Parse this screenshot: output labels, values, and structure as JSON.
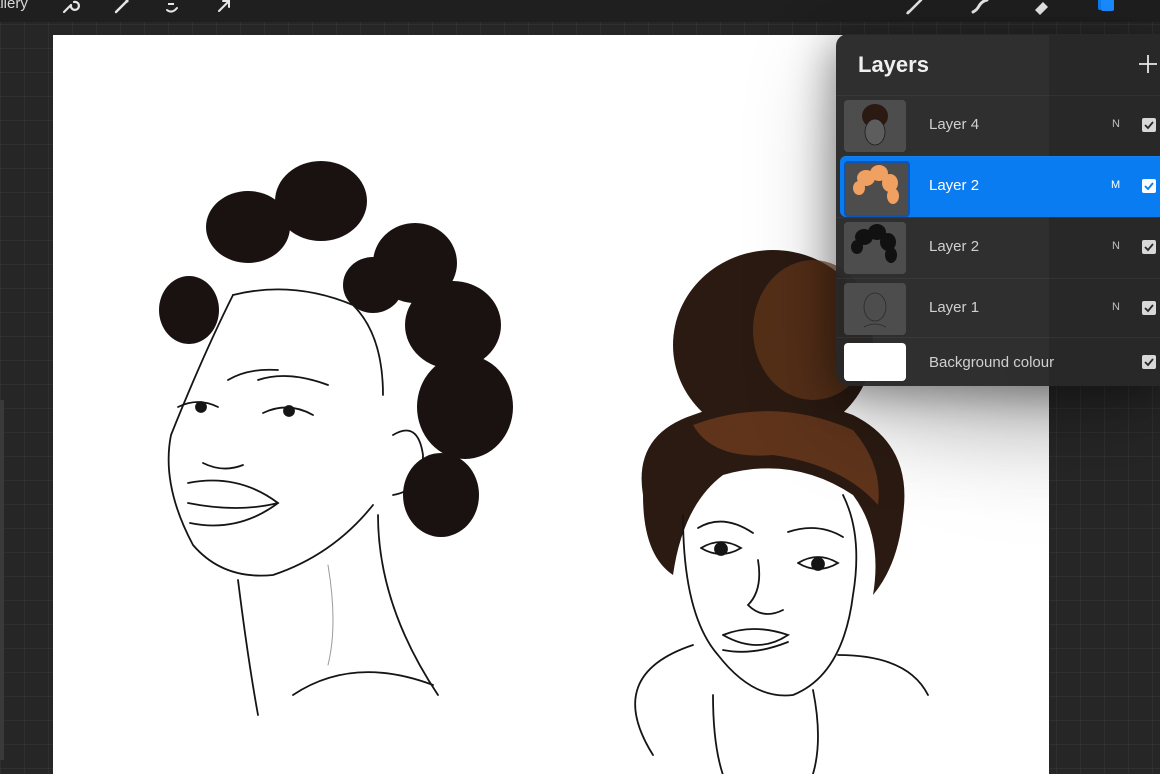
{
  "topbar": {
    "gallery_label": "allery",
    "tools": [
      "wrench-icon",
      "magic-wand-icon",
      "selection-icon",
      "transform-arrow-icon",
      "brush-icon",
      "smudge-icon",
      "eraser-icon",
      "layers-icon"
    ]
  },
  "layers_panel": {
    "title": "Layers",
    "add_icon": "plus-icon",
    "layers": [
      {
        "name": "Layer 4",
        "blend": "N",
        "visible": true,
        "selected": false
      },
      {
        "name": "Layer 2",
        "blend": "M",
        "visible": true,
        "selected": true
      },
      {
        "name": "Layer 2",
        "blend": "N",
        "visible": true,
        "selected": false
      },
      {
        "name": "Layer 1",
        "blend": "N",
        "visible": true,
        "selected": false
      }
    ],
    "background": {
      "name": "Background colour",
      "visible": true
    }
  },
  "colors": {
    "accent": "#0a7cf2",
    "panel": "#282828",
    "canvas": "#ffffff",
    "hair_dark": "#1a1210",
    "hair_brown": "#6b3a1c",
    "thumb_orange": "#f0a060"
  }
}
